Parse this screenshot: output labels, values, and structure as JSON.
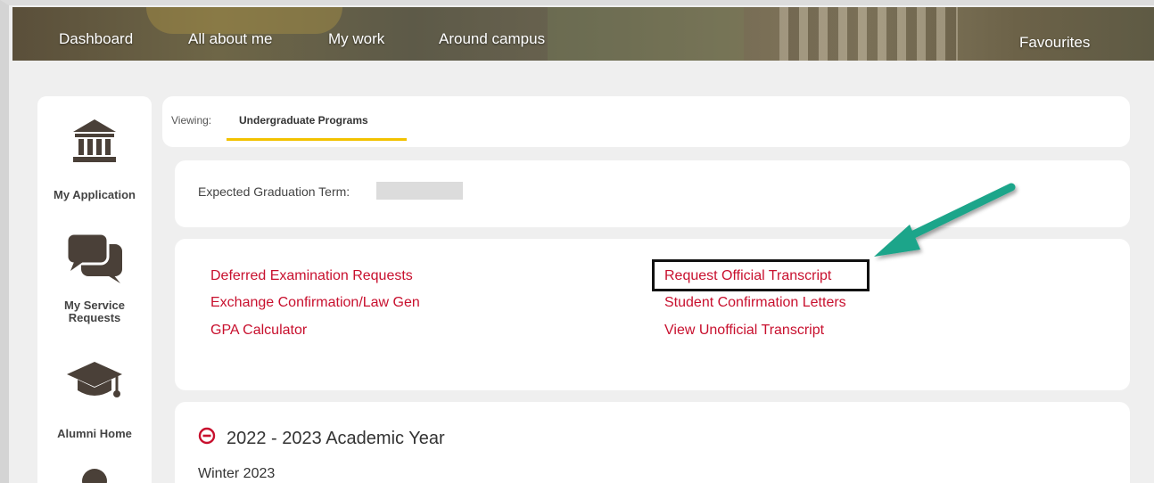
{
  "topnav": {
    "items": [
      "Dashboard",
      "All about me",
      "My work",
      "Around campus"
    ],
    "favourites": "Favourites"
  },
  "sidebar": {
    "items": [
      {
        "label": "My Application",
        "icon": "bank-icon"
      },
      {
        "label": "My Service Requests",
        "icon": "chat-bubbles-icon"
      },
      {
        "label": "Alumni Home",
        "icon": "graduation-cap-icon"
      },
      {
        "label": "",
        "icon": "person-icon"
      }
    ]
  },
  "viewing": {
    "label": "Viewing:",
    "tab": "Undergraduate Programs"
  },
  "graduation": {
    "label": "Expected Graduation Term:"
  },
  "links": {
    "left": [
      "Deferred Examination Requests",
      "Exchange Confirmation/Law Gen",
      "GPA Calculator"
    ],
    "right": [
      "Request Official Transcript",
      "Student Confirmation Letters",
      "View Unofficial Transcript"
    ]
  },
  "academic": {
    "year_title": "2022 - 2023 Academic Year",
    "term": "Winter 2023"
  },
  "colors": {
    "link": "#c8102e",
    "tab_underline": "#f2c200",
    "arrow": "#1fa58a",
    "icon": "#4a4038"
  }
}
